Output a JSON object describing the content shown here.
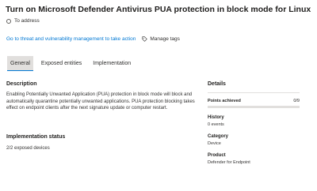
{
  "page": {
    "title": "Turn on Microsoft Defender Antivirus PUA protection in block mode for Linux",
    "status": "To address"
  },
  "actions": {
    "link": "Go to threat and vulnerability management to take action",
    "manage_tags": "Manage tags"
  },
  "tabs": [
    {
      "label": "General",
      "active": true
    },
    {
      "label": "Exposed entities",
      "active": false
    },
    {
      "label": "Implementation",
      "active": false
    }
  ],
  "description": {
    "heading": "Description",
    "text": "Enabling Potentially Unwanted Application (PUA) protection in block mode will block and automatically quarantine potentially unwanted applications. PUA protection blocking takes effect on endpoint clients after the next signature update or computer restart."
  },
  "implementation_status": {
    "heading": "Implementation status",
    "value": "2/2 exposed devices"
  },
  "details": {
    "heading": "Details",
    "points_label": "Points achieved",
    "points_value": "0/9",
    "points_fraction": 0,
    "history_label": "History",
    "history_value": "0 events",
    "category_label": "Category",
    "category_value": "Device",
    "product_label": "Product",
    "product_value": "Defender for Endpoint"
  },
  "colors": {
    "accent": "#0078d4",
    "tab_active_bg": "#e1dfdd"
  },
  "icons": {
    "status": "radio-circle-icon",
    "tags": "tag-icon"
  }
}
